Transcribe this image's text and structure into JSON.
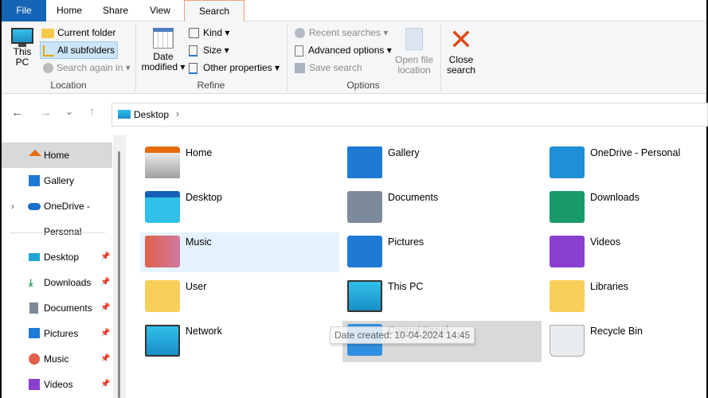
{
  "tabs": [
    "File",
    "Home",
    "Share",
    "View",
    "Search"
  ],
  "ribbon": {
    "location": {
      "this_pc": "This\nPC",
      "current_folder": "Current folder",
      "all_subfolders": "All subfolders",
      "search_again": "Search again in",
      "group": "Location"
    },
    "refine": {
      "date_modified_1": "Date",
      "date_modified_2": "modified",
      "kind": "Kind",
      "size": "Size",
      "other": "Other properties",
      "group": "Refine"
    },
    "options": {
      "recent": "Recent searches",
      "advanced": "Advanced options",
      "save": "Save search",
      "open_1": "Open file",
      "open_2": "location",
      "group": "Options"
    },
    "close": {
      "l1": "Close",
      "l2": "search"
    }
  },
  "address": {
    "path": "Desktop"
  },
  "sidebar": [
    {
      "label": "Home"
    },
    {
      "label": "Gallery"
    },
    {
      "label": "OneDrive - Personal"
    },
    {
      "label": "Desktop"
    },
    {
      "label": "Downloads"
    },
    {
      "label": "Documents"
    },
    {
      "label": "Pictures"
    },
    {
      "label": "Music"
    },
    {
      "label": "Videos"
    }
  ],
  "items": [
    {
      "label": "Home"
    },
    {
      "label": "Gallery"
    },
    {
      "label": "OneDrive - Personal"
    },
    {
      "label": "Desktop"
    },
    {
      "label": "Documents"
    },
    {
      "label": "Downloads"
    },
    {
      "label": "Music"
    },
    {
      "label": "Pictures"
    },
    {
      "label": "Videos"
    },
    {
      "label": "User"
    },
    {
      "label": "This PC"
    },
    {
      "label": "Libraries"
    },
    {
      "label": "Network"
    },
    {
      "label": "Control Panel"
    },
    {
      "label": "Recycle Bin"
    }
  ],
  "tooltip": "Date created: 10-04-2024 14:45"
}
